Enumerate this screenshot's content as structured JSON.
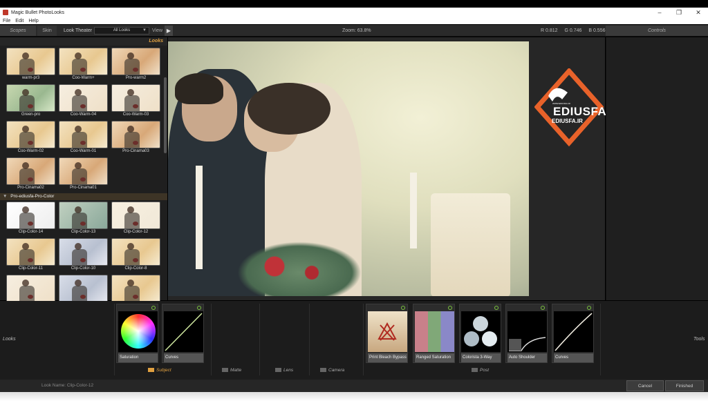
{
  "window": {
    "title": "Magic Bullet PhotoLooks",
    "controls": [
      "–",
      "❐",
      "✕"
    ]
  },
  "menu": [
    "File",
    "Edit",
    "Help"
  ],
  "toolbar": {
    "scopes_tab": "Scopes",
    "skin_tab": "Skin",
    "look_theater_label": "Look Theater",
    "filter_value": "All Looks",
    "view_label": "View",
    "play_icon": "▶",
    "zoom": "Zoom:  63.8%",
    "rgb": [
      "R 0.812",
      "G 0.746",
      "B 0.556"
    ],
    "controls_tab": "Controls"
  },
  "looks_panel": {
    "header": "Looks",
    "group1": [
      {
        "label": "warm-pr3",
        "tone": "warm"
      },
      {
        "label": "Coo-Warm+",
        "tone": "warm"
      },
      {
        "label": "Pro-warm2",
        "tone": "cine"
      },
      {
        "label": "Green-pro",
        "tone": "green"
      },
      {
        "label": "Coo-Warm-04",
        "tone": "pale"
      },
      {
        "label": "Coo-Warm-03",
        "tone": "pale"
      },
      {
        "label": "Coo-Warm-02",
        "tone": "warm"
      },
      {
        "label": "Coo-Warm-01",
        "tone": "warm"
      },
      {
        "label": "Pro-Cinama03",
        "tone": "cine"
      },
      {
        "label": "Pro-Cinama02",
        "tone": "cine"
      },
      {
        "label": "Pro-Cinama01",
        "tone": "cine"
      }
    ],
    "group2_title": "Pro-ediusfa-Pro-Color",
    "group2": [
      {
        "label": "Clip-Color-14",
        "tone": "white"
      },
      {
        "label": "Clip-Color-13",
        "tone": "teal"
      },
      {
        "label": "Clip-Color-12",
        "tone": "yellow"
      },
      {
        "label": "Clip-Color-11",
        "tone": "warm"
      },
      {
        "label": "Clip-Color-10",
        "tone": "cool"
      },
      {
        "label": "Clip-Color-8",
        "tone": "warm"
      },
      {
        "label": "",
        "tone": "pale"
      },
      {
        "label": "",
        "tone": "cool"
      },
      {
        "label": "",
        "tone": "warm"
      }
    ]
  },
  "watermark": {
    "brand": "EDIUSFA",
    "site": "EDIUSFA.IR",
    "tiny": "WWW.EDIUSFA.IR"
  },
  "bottom": {
    "left_label": "Looks",
    "right_label": "Tools",
    "subject_tools": [
      {
        "name": "Saturation",
        "preview": "color-wheel"
      },
      {
        "name": "Curves",
        "preview": "curve"
      }
    ],
    "post_tools": [
      {
        "name": "Print Bleach Bypass",
        "preview": "bleach"
      },
      {
        "name": "Ranged Saturation",
        "preview": "bars"
      },
      {
        "name": "Colorista 3-Way",
        "preview": "three-way"
      },
      {
        "name": "Auto Shoulder",
        "preview": "shoulder"
      },
      {
        "name": "Curves",
        "preview": "curve"
      }
    ],
    "stages": {
      "subject": "Subject",
      "matte": "Matte",
      "lens": "Lens",
      "camera": "Camera",
      "post": "Post"
    }
  },
  "status": {
    "text": "Look Name: Clip-Color-12",
    "cancel": "Cancel",
    "finished": "Finished"
  },
  "colors": {
    "accent": "#e0a040",
    "power_led": "#7bc43f",
    "logo_orange": "#e8622a"
  }
}
